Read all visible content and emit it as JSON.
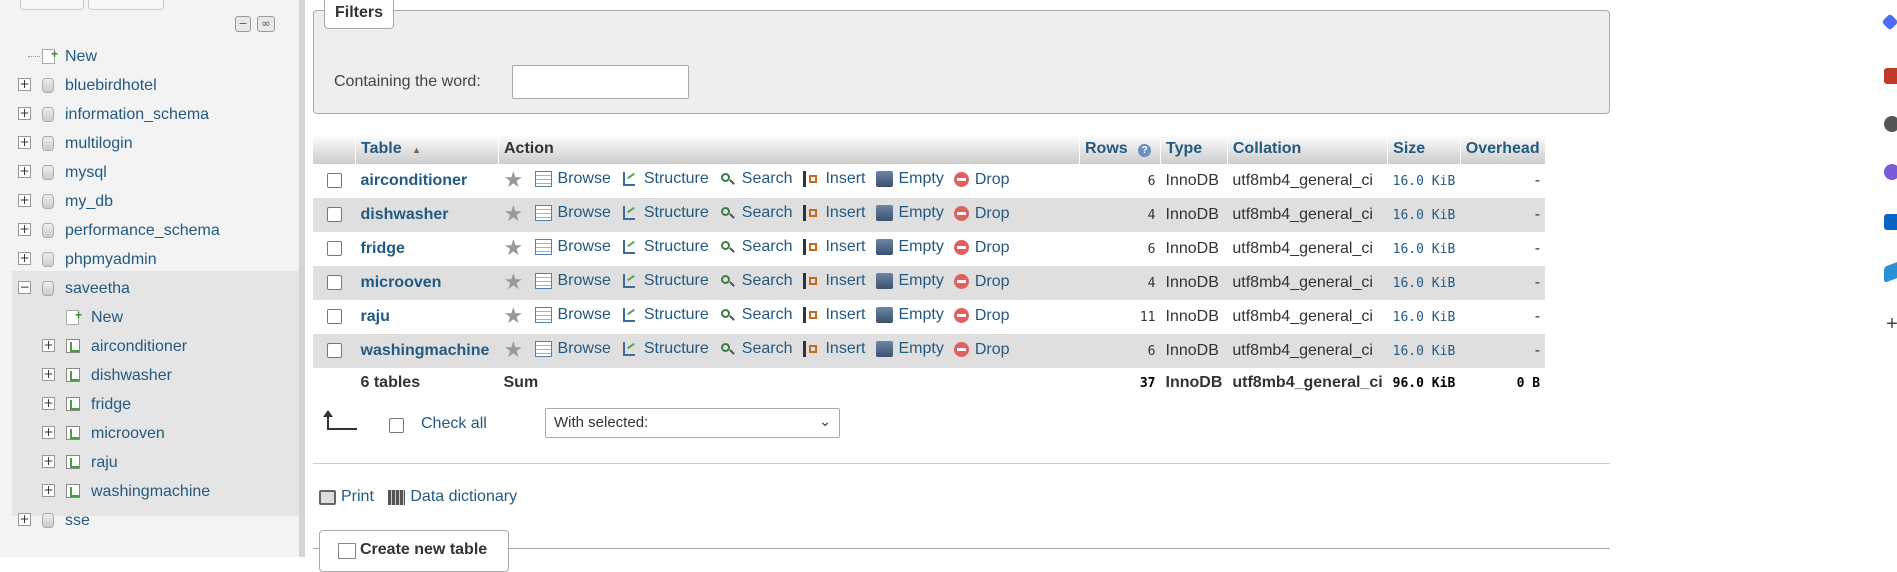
{
  "nav": {
    "tree": [
      {
        "label": "New",
        "type": "new"
      },
      {
        "label": "bluebirdhotel",
        "type": "db"
      },
      {
        "label": "information_schema",
        "type": "db"
      },
      {
        "label": "multilogin",
        "type": "db"
      },
      {
        "label": "mysql",
        "type": "db"
      },
      {
        "label": "my_db",
        "type": "db"
      },
      {
        "label": "performance_schema",
        "type": "db"
      },
      {
        "label": "phpmyadmin",
        "type": "db"
      },
      {
        "label": "saveetha",
        "type": "db",
        "expanded": true
      },
      {
        "label": "New",
        "type": "new-child"
      },
      {
        "label": "airconditioner",
        "type": "table"
      },
      {
        "label": "dishwasher",
        "type": "table"
      },
      {
        "label": "fridge",
        "type": "table"
      },
      {
        "label": "microoven",
        "type": "table"
      },
      {
        "label": "raju",
        "type": "table"
      },
      {
        "label": "washingmachine",
        "type": "table"
      },
      {
        "label": "sse",
        "type": "db"
      }
    ]
  },
  "filters": {
    "legend": "Filters",
    "label": "Containing the word:",
    "value": ""
  },
  "table": {
    "headers": {
      "table": "Table",
      "action": "Action",
      "rows": "Rows",
      "type": "Type",
      "collation": "Collation",
      "size": "Size",
      "overhead": "Overhead"
    },
    "actions": {
      "browse": "Browse",
      "structure": "Structure",
      "search": "Search",
      "insert": "Insert",
      "empty": "Empty",
      "drop": "Drop"
    },
    "rows": [
      {
        "name": "airconditioner",
        "rows": "6",
        "type": "InnoDB",
        "collation": "utf8mb4_general_ci",
        "size": "16.0 KiB",
        "overhead": "-"
      },
      {
        "name": "dishwasher",
        "rows": "4",
        "type": "InnoDB",
        "collation": "utf8mb4_general_ci",
        "size": "16.0 KiB",
        "overhead": "-"
      },
      {
        "name": "fridge",
        "rows": "6",
        "type": "InnoDB",
        "collation": "utf8mb4_general_ci",
        "size": "16.0 KiB",
        "overhead": "-"
      },
      {
        "name": "microoven",
        "rows": "4",
        "type": "InnoDB",
        "collation": "utf8mb4_general_ci",
        "size": "16.0 KiB",
        "overhead": "-"
      },
      {
        "name": "raju",
        "rows": "11",
        "type": "InnoDB",
        "collation": "utf8mb4_general_ci",
        "size": "16.0 KiB",
        "overhead": "-"
      },
      {
        "name": "washingmachine",
        "rows": "6",
        "type": "InnoDB",
        "collation": "utf8mb4_general_ci",
        "size": "16.0 KiB",
        "overhead": "-"
      }
    ],
    "summary": {
      "tables": "6 tables",
      "sum": "Sum",
      "rows": "37",
      "type": "InnoDB",
      "collation": "utf8mb4_general_ci",
      "size": "96.0 KiB",
      "overhead": "0 B"
    }
  },
  "footer": {
    "check_all": "Check all",
    "with_selected": "With selected:",
    "print": "Print",
    "data_dictionary": "Data dictionary",
    "create_table": "Create new table"
  },
  "colors": {
    "link": "#235a81",
    "nav_bg": "#f3f3f3",
    "row_alt": "#dfdfdf"
  }
}
